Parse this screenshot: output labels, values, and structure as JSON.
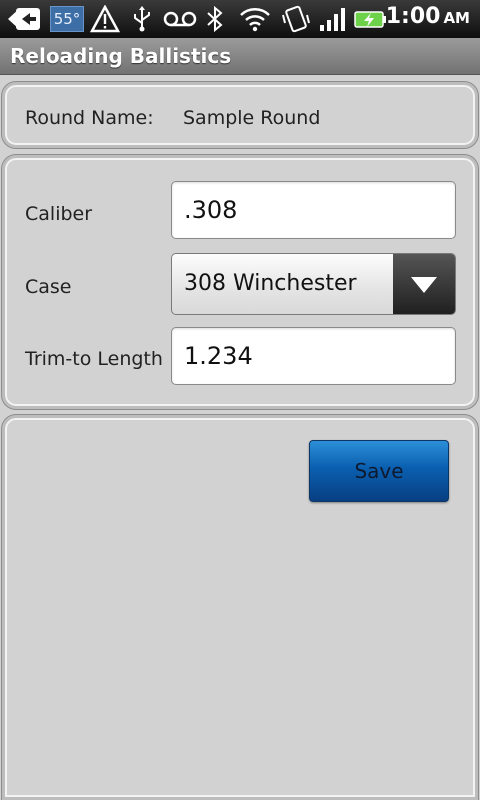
{
  "status_bar": {
    "temperature": "55°",
    "time": "1:00",
    "ampm": "AM"
  },
  "app": {
    "title": "Reloading Ballistics"
  },
  "round": {
    "label": "Round Name:",
    "value": "Sample Round"
  },
  "fields": {
    "caliber": {
      "label": "Caliber",
      "value": ".308"
    },
    "case": {
      "label": "Case",
      "selected": "308 Winchester"
    },
    "trim_length": {
      "label": "Trim-to Length",
      "value": "1.234"
    }
  },
  "actions": {
    "save_label": "Save"
  },
  "colors": {
    "background": "#d2d2d2",
    "accent_button": "#0a5fb0",
    "titlebar": "#8a8a8a"
  },
  "icons": [
    "back-arrow-icon",
    "weather-badge",
    "warning-icon",
    "usb-icon",
    "voicemail-icon",
    "bluetooth-icon",
    "wifi-icon",
    "vibrate-icon",
    "signal-icon",
    "battery-charging-icon",
    "dropdown-arrow-icon"
  ]
}
